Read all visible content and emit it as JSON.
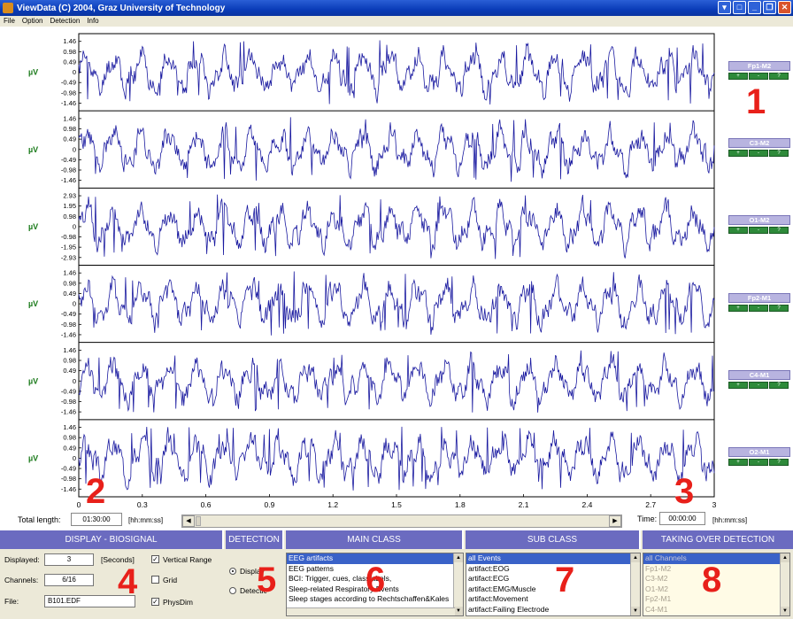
{
  "window": {
    "title": "ViewData (C) 2004, Graz University of Technology",
    "buttons": [
      "▾",
      "□",
      "_",
      "❐",
      "✕"
    ]
  },
  "menu": [
    "File",
    "Option",
    "Detection",
    "Info"
  ],
  "channels": [
    {
      "label": "Fp1-M2",
      "unit": "µV",
      "ticks": [
        "1.46",
        "0.98",
        "0.49",
        "0",
        "-0.49",
        "-0.98",
        "-1.46"
      ],
      "range": 1.46,
      "seed": 11,
      "base": 0.25
    },
    {
      "label": "C3-M2",
      "unit": "µV",
      "ticks": [
        "1.46",
        "0.98",
        "0.49",
        "0",
        "-0.49",
        "-0.98",
        "-1.46"
      ],
      "range": 1.46,
      "seed": 23,
      "base": 0.2
    },
    {
      "label": "O1-M2",
      "unit": "µV",
      "ticks": [
        "2.93",
        "1.95",
        "0.98",
        "0",
        "-0.98",
        "-1.95",
        "-2.93"
      ],
      "range": 2.93,
      "seed": 37,
      "base": 0.15
    },
    {
      "label": "Fp2-M1",
      "unit": "µV",
      "ticks": [
        "1.46",
        "0.98",
        "0.49",
        "0",
        "-0.49",
        "-0.98",
        "-1.46"
      ],
      "range": 1.46,
      "seed": 41,
      "base": 0.2
    },
    {
      "label": "C4-M1",
      "unit": "µV",
      "ticks": [
        "1.46",
        "0.98",
        "0.49",
        "0",
        "-0.49",
        "-0.98",
        "-1.46"
      ],
      "range": 1.46,
      "seed": 53,
      "base": 0.25
    },
    {
      "label": "O2-M1",
      "unit": "µV",
      "ticks": [
        "1.46",
        "0.98",
        "0.49",
        "0",
        "-0.49",
        "-0.98",
        "-1.46"
      ],
      "range": 1.46,
      "seed": 67,
      "base": 0.25
    }
  ],
  "channel_buttons": [
    "+",
    "-",
    "?"
  ],
  "x_ticks": [
    "0",
    "0.3",
    "0.6",
    "0.9",
    "1.2",
    "1.5",
    "1.8",
    "2.1",
    "2.4",
    "2.7",
    "3"
  ],
  "annotations": [
    "1",
    "2",
    "3",
    "4",
    "5",
    "6",
    "7",
    "8"
  ],
  "total_length": {
    "label": "Total length:",
    "value": "01:30:00",
    "unit": "[hh:mm:ss]"
  },
  "time": {
    "label": "Time:",
    "value": "00:00:00",
    "unit": "[hh:mm:ss]"
  },
  "panels": {
    "display": {
      "header": "DISPLAY - BIOSIGNAL",
      "displayed_label": "Displayed:",
      "displayed_value": "3",
      "displayed_unit": "[Seconds]",
      "channels_label": "Channels:",
      "channels_value": "6/16",
      "file_label": "File:",
      "file_value": "B101.EDF",
      "vertical_range": "Vertical Range",
      "grid": "Grid",
      "physdim": "PhysDim",
      "vertical_range_checked": true,
      "grid_checked": false,
      "physdim_checked": true
    },
    "detection": {
      "header": "DETECTION",
      "opt1": "Display",
      "opt2": "Detection"
    },
    "main_class": {
      "header": "MAIN CLASS",
      "items": [
        "EEG artifacts",
        "EEG patterns",
        "BCI: Trigger, cues, classlabels,",
        "Sleep-related Respiratory Events",
        "Sleep stages according to Rechtschaffen&Kales"
      ]
    },
    "sub_class": {
      "header": "SUB CLASS",
      "items": [
        "all Events",
        "artifact:EOG",
        "artifact:ECG",
        "artifact:EMG/Muscle",
        "artifact:Movement",
        "artifact:Failing Electrode"
      ]
    },
    "taking_over": {
      "header": "TAKING OVER DETECTION",
      "items": [
        "all Channels",
        "Fp1-M2",
        "C3-M2",
        "O1-M2",
        "Fp2-M1",
        "C4-M1"
      ]
    }
  },
  "colors": {
    "signal": "#1a1aa0",
    "unit": "#1a7a1a",
    "annotation": "#e8201a",
    "header": "#6b6bc0"
  }
}
